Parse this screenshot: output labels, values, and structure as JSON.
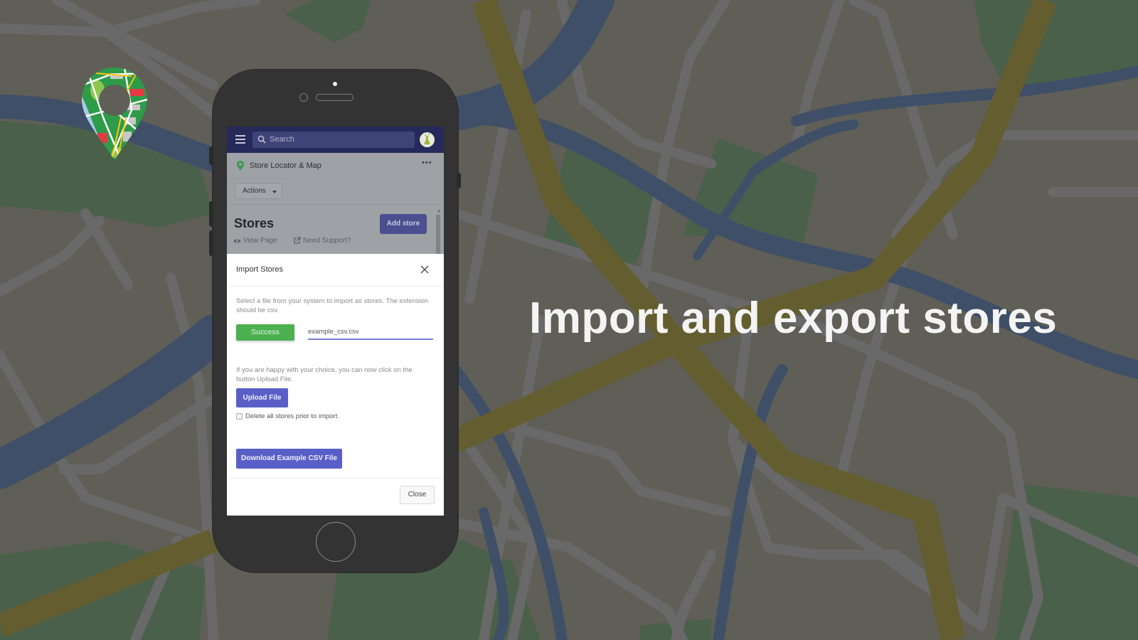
{
  "headline": "Import and export stores",
  "colors": {
    "map_land": "#5f5f57",
    "map_road": "#696969",
    "map_water": "#3f4f68",
    "map_park": "#4a604a",
    "map_highway": "#645d2f",
    "topbar": "#252a5a",
    "primary_button": "#5a5fc7",
    "success_button": "#4cb050",
    "headline_text": "#f4f4f4"
  },
  "phone_app": {
    "topbar": {
      "menu_icon": "hamburger-icon",
      "search_placeholder": "Search",
      "avatar_icon": "flask-avatar-icon"
    },
    "app_header": {
      "app_icon": "map-pin-icon",
      "title": "Store Locator & Map",
      "more_icon": "more-dots-icon",
      "more_label": "•••"
    },
    "actions_label": "Actions",
    "page_title": "Stores",
    "add_store_label": "Add store",
    "links": [
      {
        "icon": "eye-icon",
        "label": "View Page"
      },
      {
        "icon": "external-link-icon",
        "label": "Need Support?"
      }
    ]
  },
  "modal": {
    "title": "Import Stores",
    "close_icon": "close-icon",
    "instructions": "Select a file from your system to import as stores. The extension should be csv.",
    "status_button": "Success",
    "file_name": "example_csv.csv",
    "upload_instructions": "If you are happy with your choice, you can now click on the button Upload File.",
    "upload_button": "Upload File",
    "delete_checkbox_label": "Delete all stores prior to import.",
    "delete_checkbox_checked": false,
    "download_button": "Download Example CSV File",
    "close_button": "Close"
  }
}
